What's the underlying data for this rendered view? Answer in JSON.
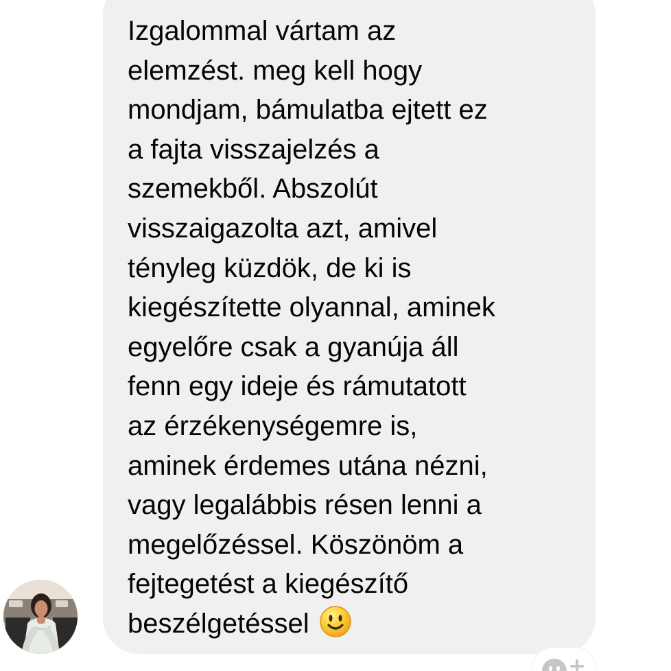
{
  "conversation": {
    "message": {
      "text": "Izgalommal vártam az\nelemzést. meg kell hogy\nmondjam, bámulatba ejtett ez\na fajta visszajelzés a\nszemekből. Abszolút\nvisszaigazolta azt, amivel\ntényleg küzdök, de ki is\nkiegészítette olyannal, aminek\negyelőre csak a gyanúja áll\nfenn egy ideje és rámutatott\naz érzékenységemre is,\naminek érdemes utána nézni,\nvagy legalábbis résen lenni a\nmegelőzéssel. Köszönöm a\nfejtegetést a kiegészítő\nbeszélgetéssel",
      "emoji": "smiling-face-emoji"
    },
    "sender": {
      "avatar": "profile-photo"
    },
    "reaction": {
      "icon": "reaction-face-icon",
      "add_icon": "plus-icon"
    }
  },
  "colors": {
    "bubble": "#f0f0f0",
    "text": "#050505",
    "emoji": "#f7c52b",
    "reaction": "#c7c7c7"
  }
}
